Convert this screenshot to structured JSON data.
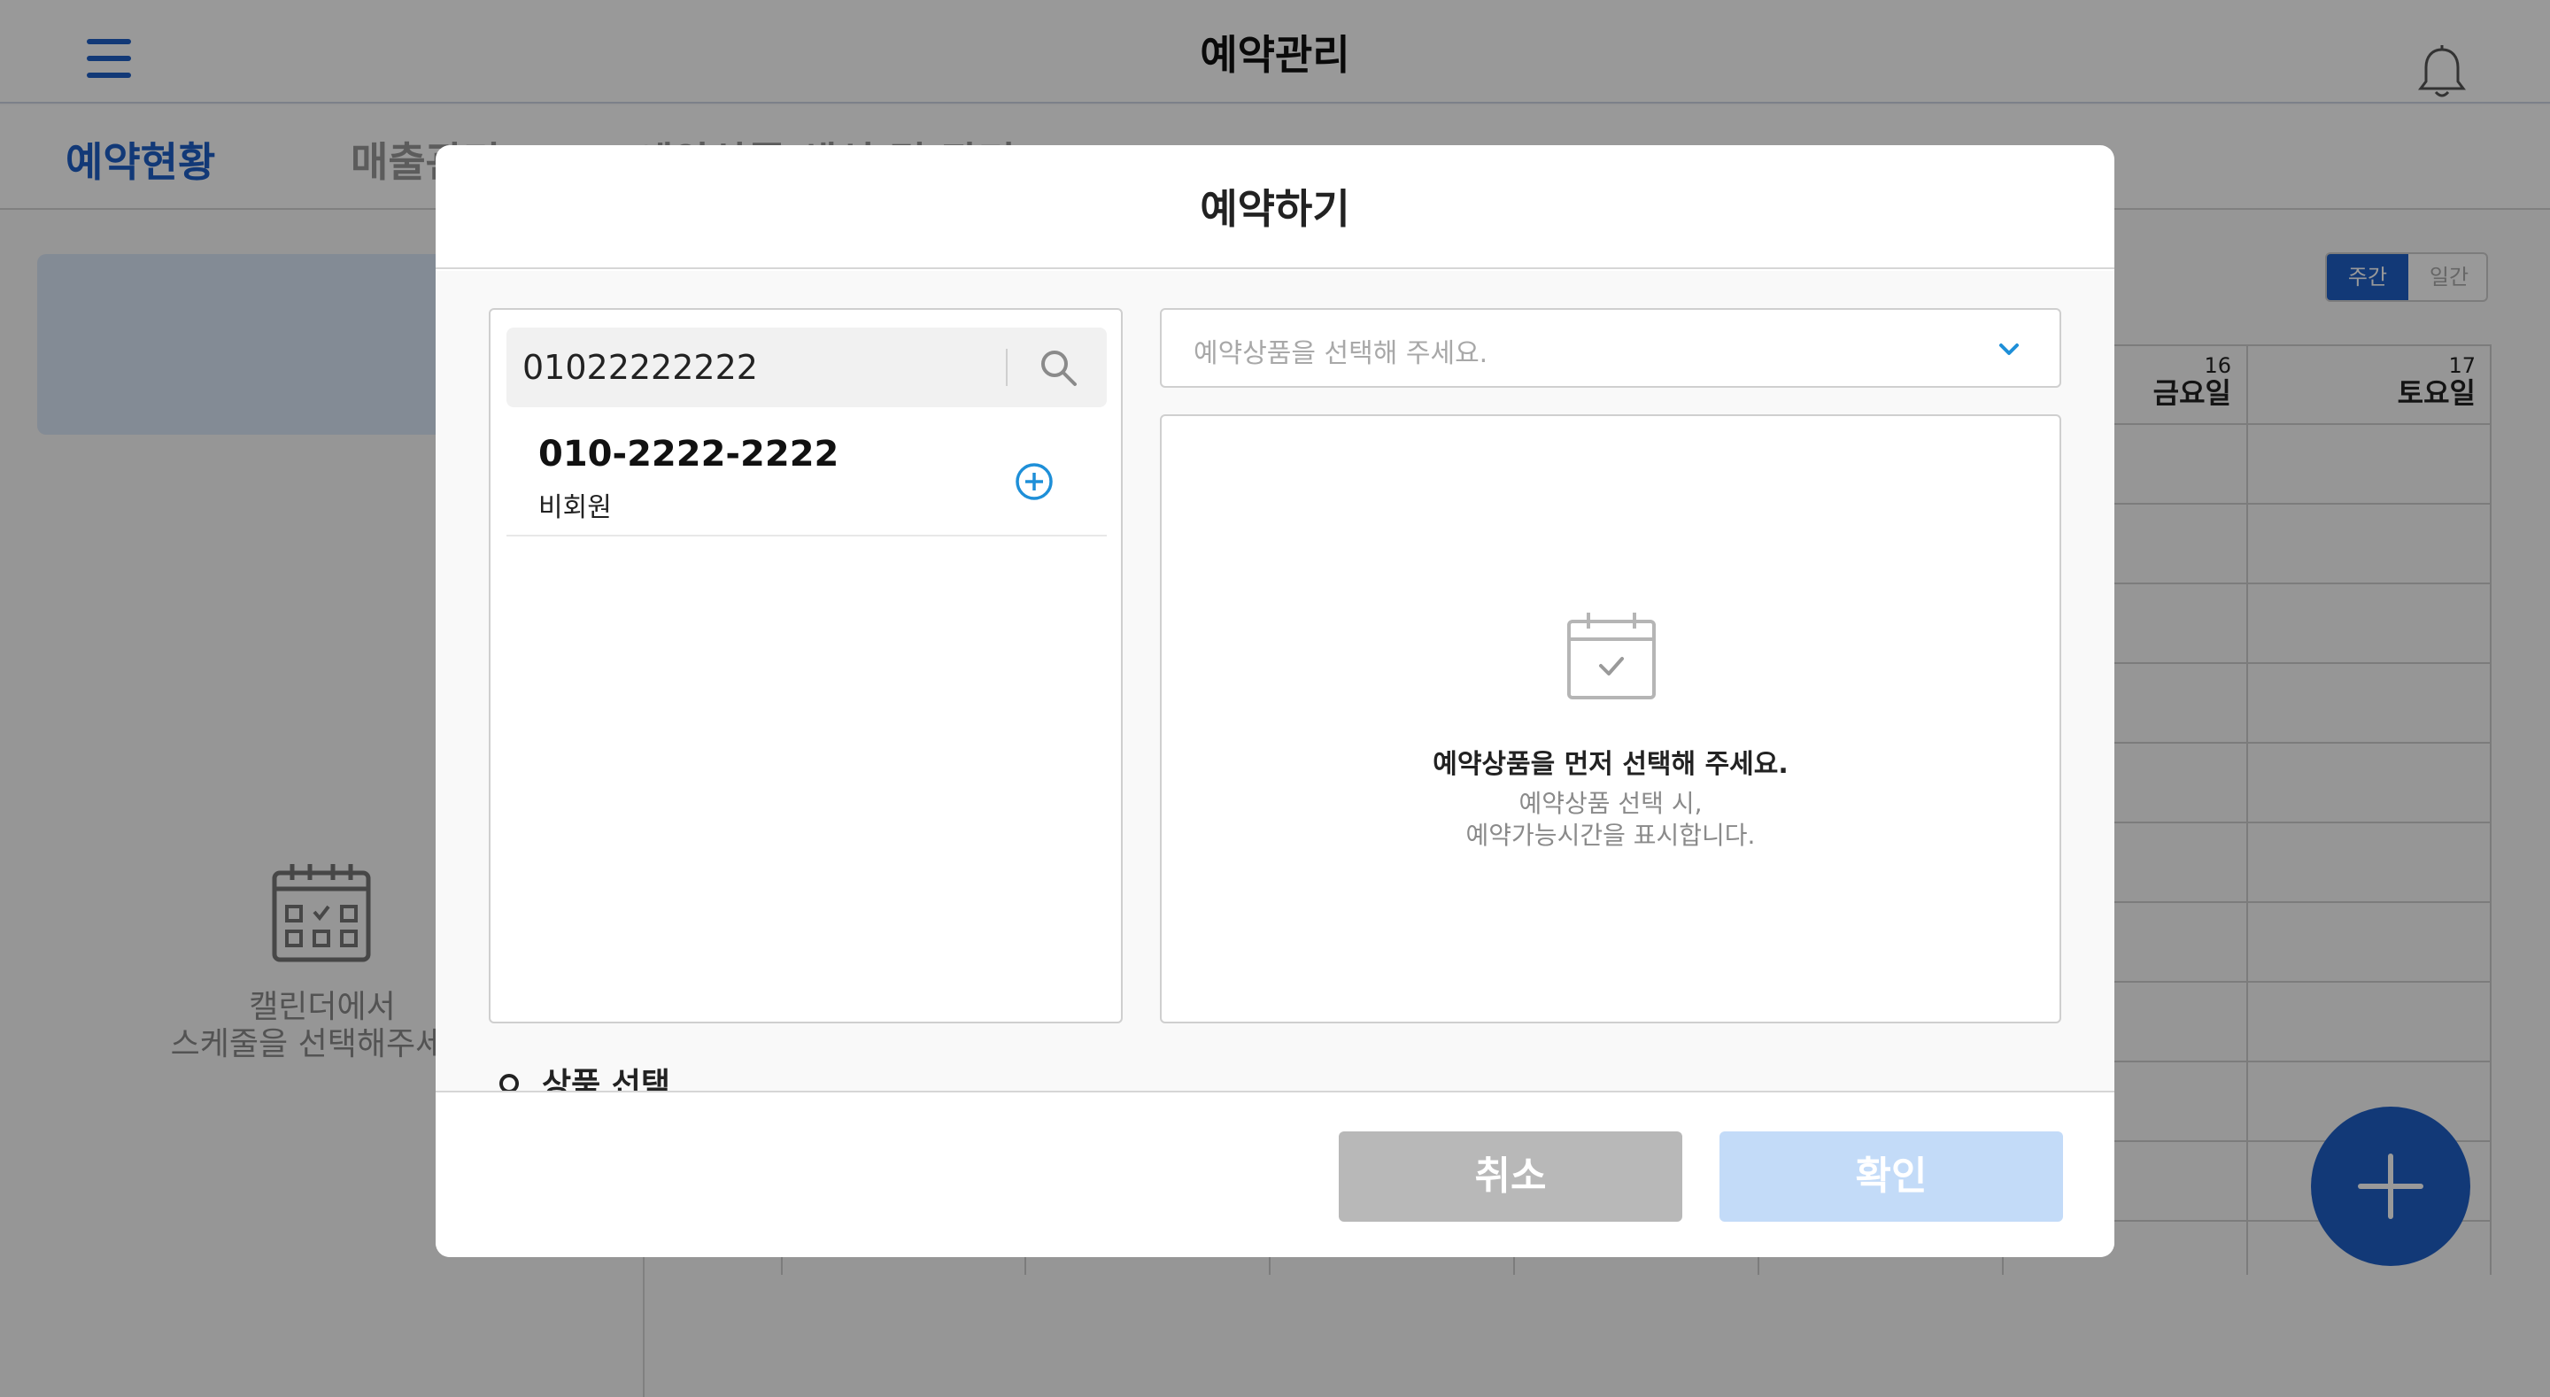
{
  "app": {
    "title": "예약관리",
    "tabs": [
      {
        "label": "예약현황",
        "active": true
      },
      {
        "label": "매출관리",
        "active": false
      },
      {
        "label": "예약상품 생성 및 관리",
        "active": false
      }
    ],
    "side_empty_text_line1": "캘린더에서",
    "side_empty_text_line2": "스케줄을 선택해주세요",
    "view_toggle": {
      "weekly": "주간",
      "daily": "일간"
    },
    "calendar_days": [
      {
        "date": "16",
        "label": "금요일"
      },
      {
        "date": "17",
        "label": "토요일"
      }
    ],
    "accent_color": "#1f5fc7"
  },
  "modal": {
    "title": "예약하기",
    "search": {
      "value": "01022222222",
      "placeholder": ""
    },
    "members": [
      {
        "phone": "010-2222-2222",
        "type": "비회원"
      }
    ],
    "product_select": {
      "placeholder": "예약상품을 선택해 주세요."
    },
    "time_panel": {
      "empty_title": "예약상품을 먼저 선택해 주세요.",
      "empty_desc_line1": "예약상품 선택 시,",
      "empty_desc_line2": "예약가능시간을 표시합니다."
    },
    "section_label": "상품 선택",
    "buttons": {
      "cancel": "취소",
      "confirm": "확인"
    }
  }
}
